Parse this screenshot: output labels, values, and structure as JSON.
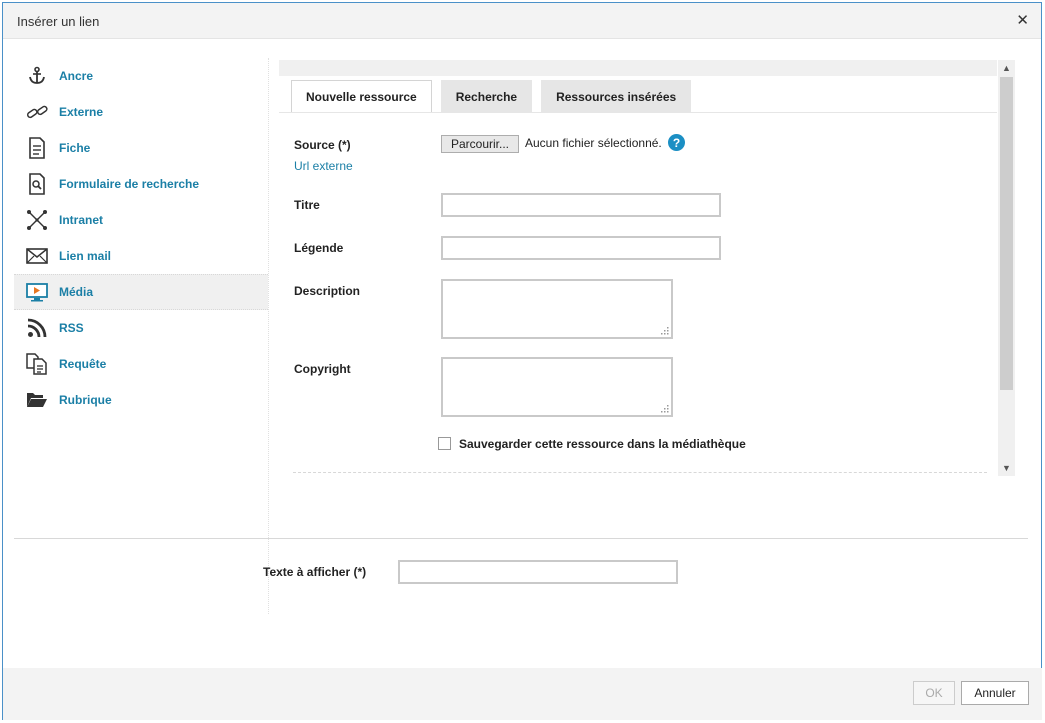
{
  "dialog": {
    "title": "Insérer un lien"
  },
  "sidebar": {
    "items": [
      {
        "label": "Ancre",
        "icon": "anchor-icon"
      },
      {
        "label": "Externe",
        "icon": "chain-link-icon"
      },
      {
        "label": "Fiche",
        "icon": "document-icon"
      },
      {
        "label": "Formulaire de recherche",
        "icon": "search-form-icon"
      },
      {
        "label": "Intranet",
        "icon": "network-icon"
      },
      {
        "label": "Lien mail",
        "icon": "envelope-icon"
      },
      {
        "label": "Média",
        "icon": "monitor-play-icon",
        "active": true
      },
      {
        "label": "RSS",
        "icon": "rss-icon"
      },
      {
        "label": "Requête",
        "icon": "query-documents-icon"
      },
      {
        "label": "Rubrique",
        "icon": "folder-open-icon"
      }
    ]
  },
  "tabs": [
    {
      "label": "Nouvelle ressource",
      "active": true
    },
    {
      "label": "Recherche"
    },
    {
      "label": "Ressources insérées"
    }
  ],
  "form": {
    "source_label": "Source (*)",
    "browse_label": "Parcourir...",
    "no_file_text": "Aucun fichier sélectionné.",
    "help_glyph": "?",
    "url_externe_link": "Url externe",
    "titre_label": "Titre",
    "titre_value": "",
    "legende_label": "Légende",
    "legende_value": "",
    "description_label": "Description",
    "copyright_label": "Copyright",
    "save_checkbox_label": "Sauvegarder cette ressource dans la médiathèque"
  },
  "bottom": {
    "texte_label": "Texte à afficher (*)",
    "texte_value": ""
  },
  "footer": {
    "ok_label": "OK",
    "cancel_label": "Annuler"
  },
  "colors": {
    "accent": "#1b7fa6",
    "help": "#1b8fc4",
    "border": "#4a90c8"
  }
}
